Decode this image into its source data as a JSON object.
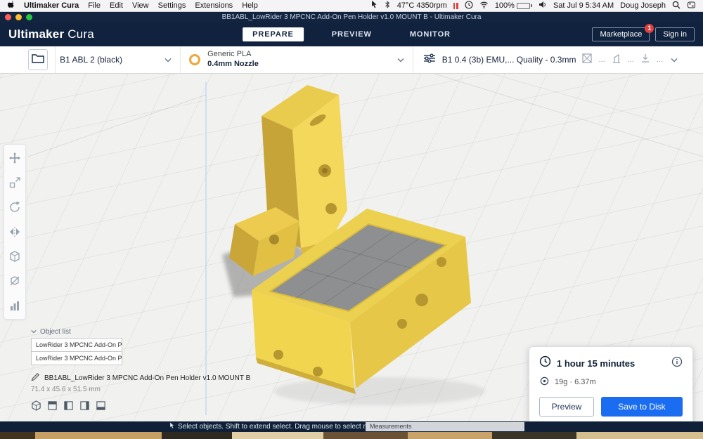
{
  "colors": {
    "accent_blue": "#1a6cf0",
    "header_navy": "#10223e",
    "model_yellow": "#f2d54e",
    "badge_red": "#e23f3f"
  },
  "menubar": {
    "app_name": "Ultimaker Cura",
    "menus": [
      "File",
      "Edit",
      "View",
      "Settings",
      "Extensions",
      "Help"
    ],
    "temp_fan": "47°C 4350rpm",
    "battery": "100%",
    "datetime": "Sat Jul 9 5:34 AM",
    "user": "Doug Joseph"
  },
  "titlebar": {
    "title": "BB1ABL_LowRider 3 MPCNC Add-On Pen Holder v1.0 MOUNT B - Ultimaker Cura"
  },
  "header": {
    "logo_primary": "Ultimaker",
    "logo_secondary": " Cura",
    "tabs": [
      {
        "label": "PREPARE",
        "active": true
      },
      {
        "label": "PREVIEW",
        "active": false
      },
      {
        "label": "MONITOR",
        "active": false
      }
    ],
    "marketplace_label": "Marketplace",
    "marketplace_badge": "1",
    "signin_label": "Sign in"
  },
  "configbar": {
    "printer_name": "B1 ABL 2 (black)",
    "material_name": "Generic PLA",
    "nozzle": "0.4mm Nozzle",
    "profile": "B1 0.4 (3b) EMU,... Quality - 0.3mm",
    "truncated": "..."
  },
  "toolbar": {
    "tools": [
      "move",
      "scale",
      "rotate",
      "mirror",
      "per-model-settings",
      "support-blocker",
      "statistics"
    ]
  },
  "object_list": {
    "label": "Object list",
    "items": [
      "LowRider 3 MPCNC Add-On P...",
      "LowRider 3 MPCNC Add-On P..."
    ],
    "model_name": "BB1ABL_LowRider 3 MPCNC Add-On Pen Holder v1.0 MOUNT B",
    "dimensions": "71.4 x 45.6 x 51.5 mm"
  },
  "action_panel": {
    "print_time": "1 hour 15 minutes",
    "material_usage": "19g · 6.37m",
    "preview_label": "Preview",
    "save_label": "Save to Disk"
  },
  "statusbar": {
    "message": "Select objects. Shift to extend select. Drag mouse to select multiple.",
    "measurements_label": "Measurements"
  },
  "icons": {
    "menubar": [
      "apple-icon",
      "cursor-icon",
      "bluetooth-icon",
      "pause-icon",
      "clock-icon",
      "wifi-icon",
      "battery-icon",
      "speaker-icon",
      "search-icon",
      "control-center-icon"
    ],
    "toolbar": [
      "move-tool-icon",
      "scale-tool-icon",
      "rotate-tool-icon",
      "mirror-tool-icon",
      "per-model-settings-icon",
      "support-blocker-icon",
      "statistics-icon"
    ]
  }
}
